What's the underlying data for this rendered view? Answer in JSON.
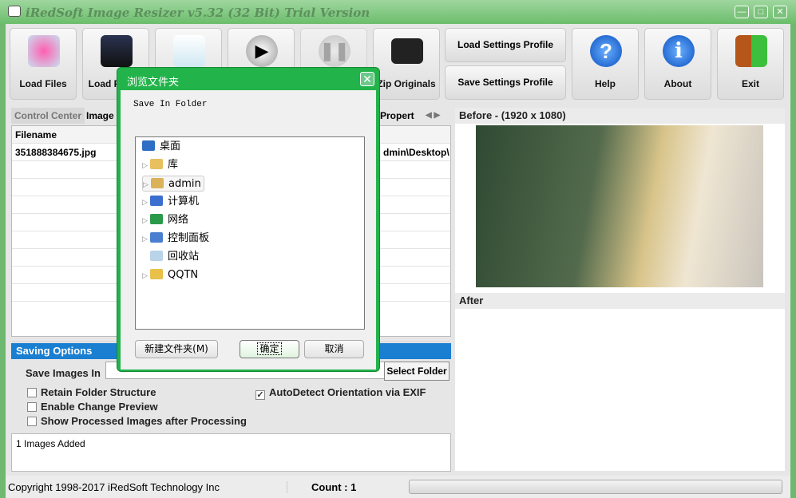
{
  "window": {
    "title": "iRedSoft Image Resizer v5.32 (32 Bit) Trial Version",
    "min": "—",
    "max": "□",
    "close": "✕"
  },
  "toolbar": {
    "buttons": [
      {
        "label": "Load Files",
        "icon": "flower-image-icon"
      },
      {
        "label": "Load Folder",
        "icon": "camera-folder-icon"
      },
      {
        "label": "",
        "icon": "blank-page-icon"
      },
      {
        "label": "",
        "icon": "play-icon"
      },
      {
        "label": "",
        "icon": "pause-icon"
      },
      {
        "label": "Zip Originals",
        "icon": "black-folder-icon"
      },
      {
        "label": "Help",
        "icon": "help-icon"
      },
      {
        "label": "About",
        "icon": "info-icon"
      },
      {
        "label": "Exit",
        "icon": "exit-door-icon"
      }
    ],
    "load_profile": "Load Settings Profile",
    "save_profile": "Save Settings Profile"
  },
  "tabs": [
    "Control Center",
    "Image",
    "Propert"
  ],
  "grid": {
    "header": "Filename",
    "rows": [
      {
        "filename": "351888384675.jpg",
        "path": "dmin\\Desktop\\"
      }
    ]
  },
  "saving": {
    "title": "Saving Options",
    "save_in_label": "Save Images In",
    "save_in_value": "",
    "select_folder": "Select Folder",
    "options": [
      {
        "label": "Retain Folder Structure",
        "checked": false
      },
      {
        "label": "Enable Change Preview",
        "checked": false
      },
      {
        "label": "Show Processed Images after Processing",
        "checked": false
      },
      {
        "label": "AutoDetect Orientation via EXIF",
        "checked": true
      }
    ]
  },
  "log": "1 Images Added",
  "preview": {
    "before": "Before - (1920 x 1080)",
    "after": "After"
  },
  "status": {
    "copyright": "Copyright 1998-2017 iRedSoft Technology Inc",
    "count": "Count : 1",
    "progress": 0
  },
  "dialog": {
    "title": "浏览文件夹",
    "prompt": "Save In Folder",
    "tree": [
      {
        "label": "桌面",
        "expand": false,
        "indent": 0
      },
      {
        "label": "库",
        "expand": true,
        "indent": 1
      },
      {
        "label": "admin",
        "expand": true,
        "indent": 1
      },
      {
        "label": "计算机",
        "expand": true,
        "indent": 1
      },
      {
        "label": "网络",
        "expand": true,
        "indent": 1
      },
      {
        "label": "控制面板",
        "expand": true,
        "indent": 1
      },
      {
        "label": "回收站",
        "expand": false,
        "indent": 1
      },
      {
        "label": "QQTN",
        "expand": true,
        "indent": 1
      }
    ],
    "new_folder": "新建文件夹(M)",
    "ok": "确定",
    "cancel": "取消"
  }
}
